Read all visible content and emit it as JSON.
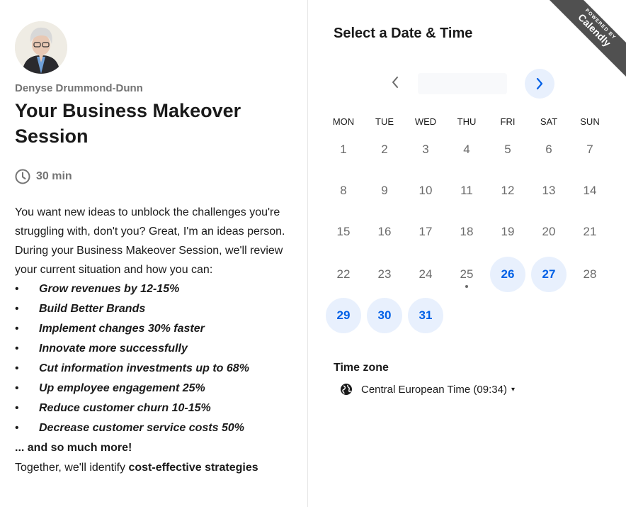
{
  "event": {
    "host_name": "Denyse Drummond-Dunn",
    "title": "Your Business Makeover Session",
    "duration": "30 min",
    "intro_1": "You want new ideas to unblock the challenges you're struggling with, don't you? Great, I'm an ideas person.",
    "intro_2": "During your Business Makeover Session, we'll review your current situation and how you can:",
    "bullet_symbol": "•",
    "bullets": [
      "Grow revenues by 12-15%",
      "Build Better Brands",
      "Implement changes 30% faster",
      "Innovate more successfully",
      "Cut information investments up to 68%",
      "Up employee engagement 25%",
      "Reduce customer churn 10-15%",
      "Decrease customer service costs 50%"
    ],
    "more": "... and so much more!",
    "closing_prefix": "Together, we'll identify ",
    "closing_bold": "cost-effective strategies"
  },
  "calendar": {
    "heading": "Select a Date & Time",
    "month_label": "",
    "prev_icon": "chevron-left-icon",
    "next_icon": "chevron-right-icon",
    "weekdays": [
      "MON",
      "TUE",
      "WED",
      "THU",
      "FRI",
      "SAT",
      "SUN"
    ],
    "days": [
      "1",
      "2",
      "3",
      "4",
      "5",
      "6",
      "7",
      "8",
      "9",
      "10",
      "11",
      "12",
      "13",
      "14",
      "15",
      "16",
      "17",
      "18",
      "19",
      "20",
      "21",
      "22",
      "23",
      "24",
      "25",
      "26",
      "27",
      "28",
      "29",
      "30",
      "31"
    ],
    "available_days": [
      "26",
      "27",
      "29",
      "30",
      "31"
    ],
    "today": "25",
    "accent_color": "#0060e6",
    "available_bg": "#e8f0fd"
  },
  "badge": {
    "top": "POWERED BY",
    "brand": "Calendly"
  },
  "timezone": {
    "label": "Time zone",
    "value": "Central European Time (09:34)",
    "icon": "globe-icon",
    "caret": "▾"
  }
}
